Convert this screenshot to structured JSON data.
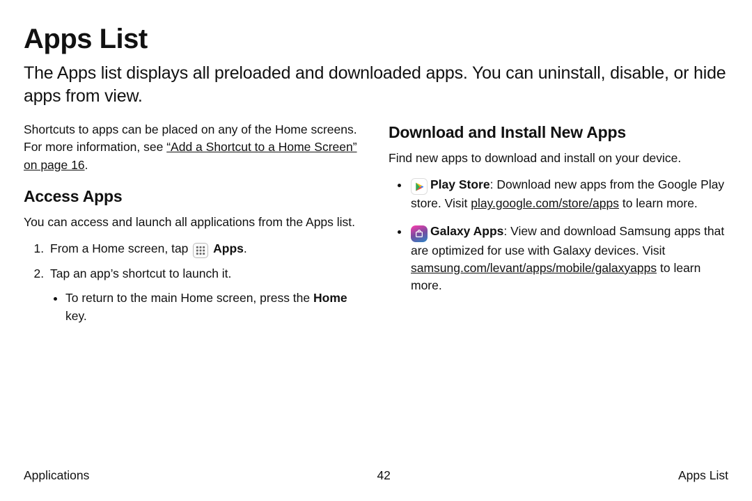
{
  "title": "Apps List",
  "intro": "The Apps list displays all preloaded and downloaded apps. You can uninstall, disable, or hide apps from view.",
  "left": {
    "shortcuts_pre": "Shortcuts to apps can be placed on any of the Home screens. For more information, see ",
    "shortcuts_link": "“Add a Shortcut to a Home Screen” on page 16",
    "shortcuts_post": ".",
    "access_heading": "Access Apps",
    "access_desc": "You can access and launch all applications from the Apps list.",
    "step1_pre": "From a Home screen, tap ",
    "step1_label": "Apps",
    "step1_post": ".",
    "step2": "Tap an app’s shortcut to launch it.",
    "step2_sub_pre": "To return to the main Home screen, press the ",
    "step2_sub_bold": "Home",
    "step2_sub_post": " key."
  },
  "right": {
    "download_heading": "Download and Install New Apps",
    "download_desc": "Find new apps to download and install on your device.",
    "play_label": "Play Store",
    "play_pre": ": Download new apps from the Google Play store. Visit ",
    "play_link": "play.google.com/store/apps",
    "play_post": " to learn more.",
    "galaxy_label": "Galaxy Apps",
    "galaxy_pre": ": View and download Samsung apps that are optimized for use with Galaxy devices. Visit ",
    "galaxy_link": "samsung.com/levant/apps/mobile/galaxyapps",
    "galaxy_post": " to learn more."
  },
  "footer": {
    "left": "Applications",
    "center": "42",
    "right": "Apps List"
  }
}
